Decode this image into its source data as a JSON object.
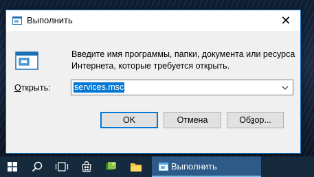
{
  "dialog": {
    "title": "Выполнить",
    "close_glyph": "✕",
    "description": "Введите имя программы, папки, документа или ресурса Интернета, которые требуется открыть.",
    "open_label_prefix": "",
    "open_label_underlined": "О",
    "open_label_rest": "ткрыть:",
    "input_value": "services.msc",
    "buttons": {
      "ok": "OK",
      "cancel": "Отмена",
      "browse_prefix": "Об",
      "browse_underlined": "з",
      "browse_rest": "ор..."
    }
  },
  "taskbar": {
    "icons": [
      "windows-start-icon",
      "search-icon",
      "task-view-icon",
      "store-icon",
      "photos-app-icon",
      "file-explorer-icon"
    ],
    "active_app": {
      "label": "Выполнить",
      "icon": "run-icon"
    }
  },
  "colors": {
    "accent": "#0078d7",
    "dialog_border": "#1979ca",
    "taskbar": "#162a3e",
    "taskbar_active": "#2d5a86"
  }
}
